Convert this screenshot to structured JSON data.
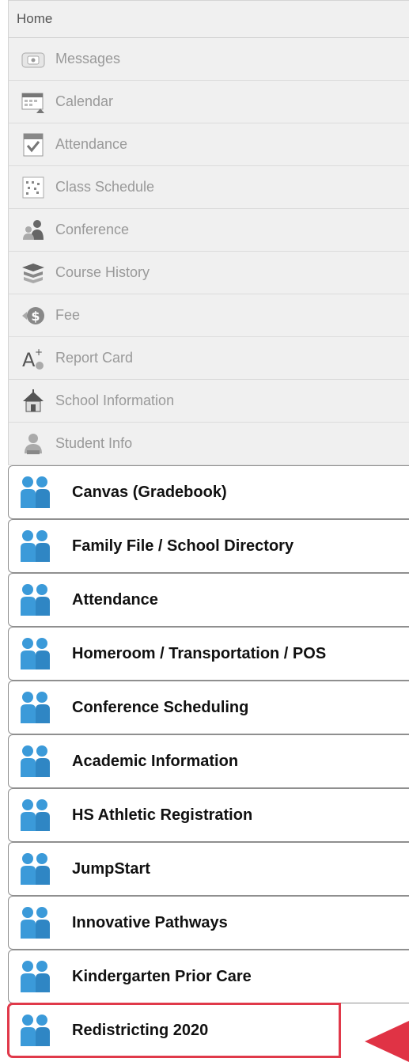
{
  "home": {
    "label": "Home"
  },
  "grey_items": [
    {
      "label": "Messages",
      "icon": "messages-icon"
    },
    {
      "label": "Calendar",
      "icon": "calendar-icon"
    },
    {
      "label": "Attendance",
      "icon": "attendance-icon"
    },
    {
      "label": "Class Schedule",
      "icon": "class-schedule-icon"
    },
    {
      "label": "Conference",
      "icon": "conference-icon"
    },
    {
      "label": "Course History",
      "icon": "course-history-icon"
    },
    {
      "label": "Fee",
      "icon": "fee-icon"
    },
    {
      "label": "Report Card",
      "icon": "report-card-icon"
    },
    {
      "label": "School Information",
      "icon": "school-information-icon"
    },
    {
      "label": "Student Info",
      "icon": "student-info-icon"
    }
  ],
  "link_items": [
    {
      "label": "Canvas (Gradebook)",
      "icon": "people-icon"
    },
    {
      "label": "Family File / School Directory",
      "icon": "people-icon"
    },
    {
      "label": "Attendance",
      "icon": "people-icon"
    },
    {
      "label": "Homeroom / Transportation / POS",
      "icon": "people-icon"
    },
    {
      "label": "Conference Scheduling",
      "icon": "people-icon"
    },
    {
      "label": "Academic Information",
      "icon": "people-icon"
    },
    {
      "label": "HS Athletic Registration",
      "icon": "people-icon"
    },
    {
      "label": "JumpStart",
      "icon": "people-icon"
    },
    {
      "label": "Innovative Pathways",
      "icon": "people-icon"
    },
    {
      "label": "Kindergarten Prior Care",
      "icon": "people-icon"
    },
    {
      "label": "Redistricting 2020",
      "icon": "people-icon",
      "highlighted": true
    }
  ],
  "colors": {
    "highlight": "#e0394a",
    "arrow": "#e03345",
    "people_icon": "#3b9ad9",
    "grey_text": "#999999"
  }
}
